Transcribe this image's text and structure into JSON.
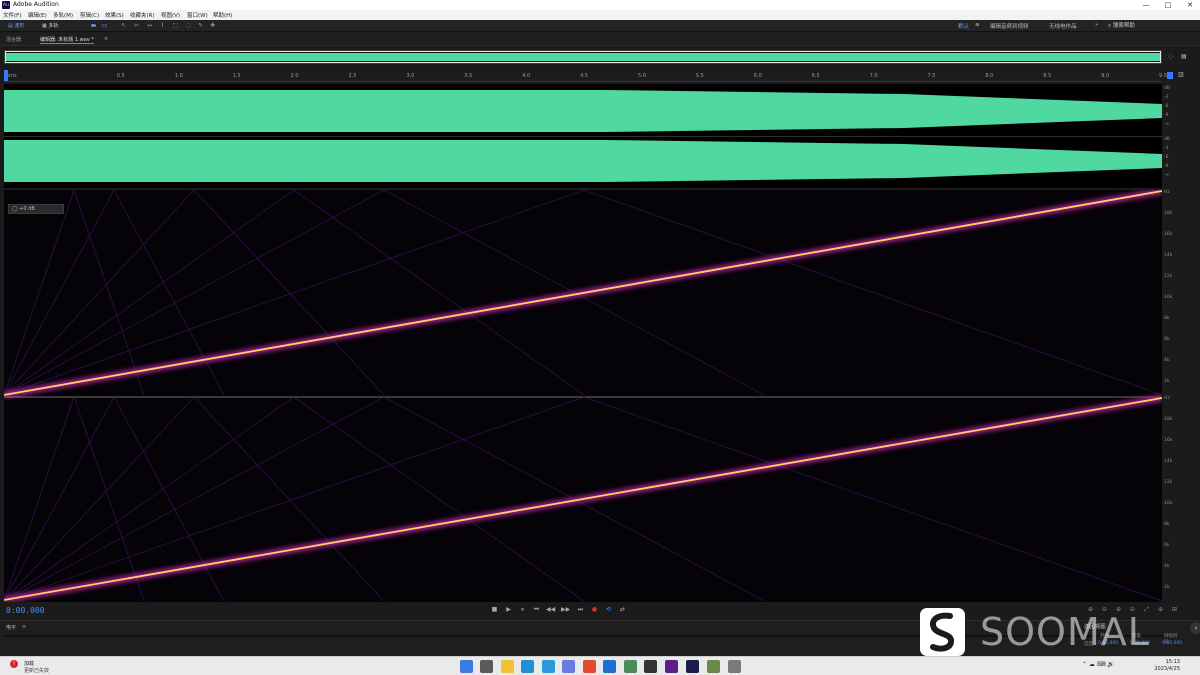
{
  "window": {
    "app_badge": "Au",
    "title": "Adobe Audition",
    "controls": [
      "—",
      "□",
      "✕"
    ]
  },
  "menu": [
    "文件(F)",
    "编辑(E)",
    "多轨(M)",
    "剪辑(C)",
    "效果(S)",
    "收藏夹(R)",
    "视图(V)",
    "窗口(W)",
    "帮助(H)"
  ],
  "toolbar": {
    "waveform_label": "波形",
    "multitrack_label": "多轨",
    "workspace": [
      "默认",
      "编辑音频到视频",
      "无线电作品"
    ],
    "search_placeholder": "搜索帮助"
  },
  "editor": {
    "tabs": [
      "混合器",
      "编辑器: 未标题 1.wav *"
    ],
    "active_tab": 1,
    "hud_value": "+0 dB"
  },
  "ruler": {
    "ticks": [
      "hms",
      "0.5",
      "1.0",
      "1.5",
      "2.0",
      "2.5",
      "3.0",
      "3.5",
      "4.0",
      "4.5",
      "5.0",
      "5.5",
      "6.0",
      "6.5",
      "7.0",
      "7.5",
      "8.0",
      "8.5",
      "9.0",
      "9.5"
    ]
  },
  "amplitude_labels": [
    "dB",
    "-3",
    "-6",
    "-9",
    "-∞",
    "-9",
    "-6",
    "-3"
  ],
  "frequency_labels": [
    "Hz",
    "18k",
    "16k",
    "14k",
    "12k",
    "10k",
    "8k",
    "6k",
    "4k",
    "2k"
  ],
  "transport": {
    "timecode": "0:00.000",
    "buttons": [
      "■",
      "▶",
      "⏸",
      "⏮",
      "◀◀",
      "▶▶",
      "⏭",
      "●",
      "⟲",
      "⇄"
    ]
  },
  "levels": {
    "label": "电平"
  },
  "selection_panel": {
    "title": "选区/视图",
    "columns": [
      "开始",
      "结束",
      "持续时间"
    ],
    "row_label": "选区",
    "values": [
      "0:00.000",
      "0:00.000",
      "0:00.000"
    ]
  },
  "watermark": {
    "text": "SOOMAL"
  },
  "taskbar": {
    "notification_title": "加载",
    "notification_sub": "更新已失效",
    "time": "15:13",
    "date": "2023/4/25"
  },
  "colors": {
    "waveform": "#4fd9a0",
    "accent": "#4a8cff",
    "sweep": "#ffcf6a"
  }
}
